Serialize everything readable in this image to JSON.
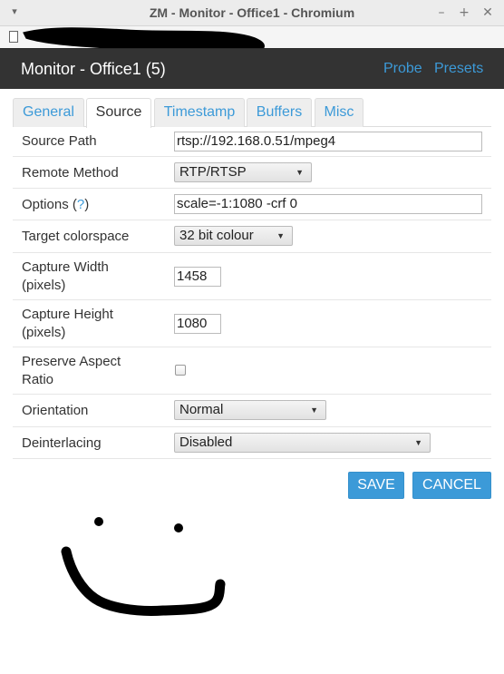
{
  "window": {
    "title": "ZM - Monitor - Office1 - Chromium",
    "menu_glyph": "▾",
    "minimize_glyph": "–",
    "maximize_glyph": "+",
    "close_glyph": "✕"
  },
  "header": {
    "title": "Monitor - Office1 (5)",
    "links": [
      "Probe",
      "Presets"
    ]
  },
  "tabs": [
    "General",
    "Source",
    "Timestamp",
    "Buffers",
    "Misc"
  ],
  "active_tab": "Source",
  "form": {
    "source_path": {
      "label": "Source Path",
      "value": "rtsp://192.168.0.51/mpeg4"
    },
    "remote_method": {
      "label": "Remote Method",
      "value": "RTP/RTSP"
    },
    "options": {
      "label": "Options (",
      "help": "?",
      "label_end": ")",
      "value": "scale=-1:1080 -crf 0"
    },
    "target_colorspace": {
      "label": "Target colorspace",
      "value": "32 bit colour"
    },
    "capture_width": {
      "label_line1": "Capture Width",
      "label_line2": "(pixels)",
      "value": "1458"
    },
    "capture_height": {
      "label_line1": "Capture Height",
      "label_line2": "(pixels)",
      "value": "1080"
    },
    "preserve_aspect": {
      "label_line1": "Preserve Aspect",
      "label_line2": "Ratio",
      "checked": false
    },
    "orientation": {
      "label": "Orientation",
      "value": "Normal"
    },
    "deinterlacing": {
      "label": "Deinterlacing",
      "value": "Disabled"
    }
  },
  "actions": {
    "save": "SAVE",
    "cancel": "CANCEL"
  },
  "colors": {
    "accent": "#3c9ad8",
    "header_bg": "#333333"
  }
}
